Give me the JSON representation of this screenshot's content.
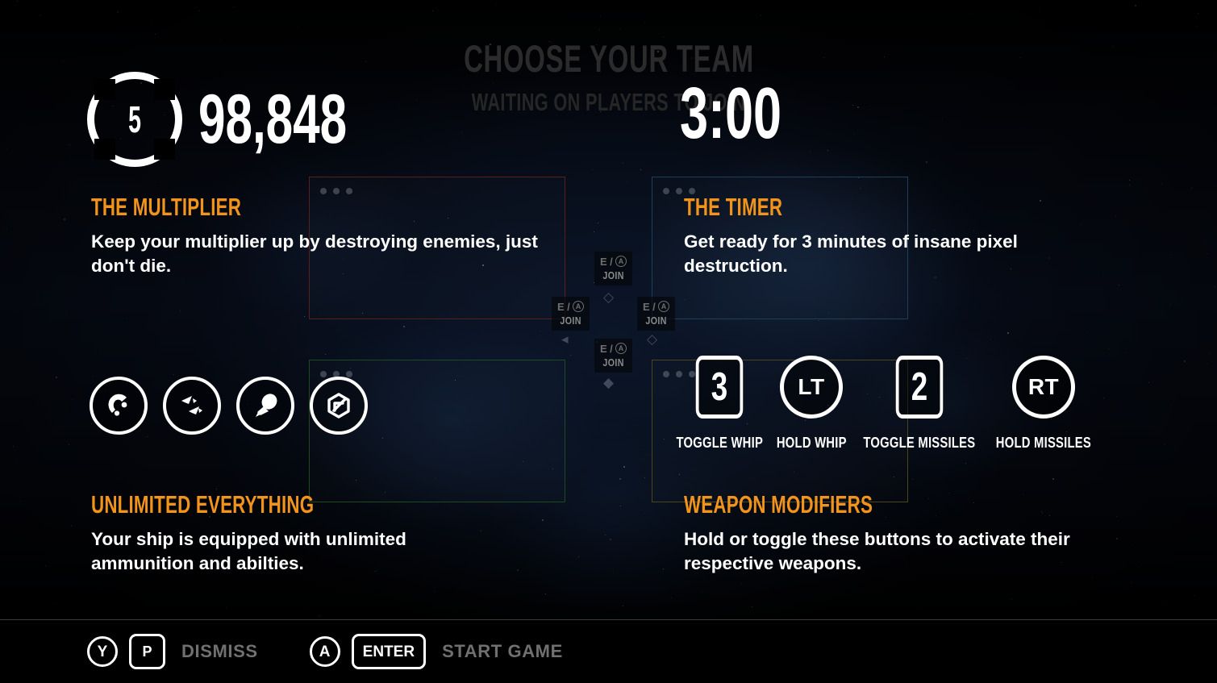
{
  "hud": {
    "multiplier_value": "5",
    "score": "98,848",
    "countdown": "3:00"
  },
  "header": {
    "title": "CHOOSE YOUR TEAM",
    "subtitle": "WAITING ON PLAYERS TO JOIN"
  },
  "join_prompts": [
    {
      "keyboard_key": "E",
      "separator": "/",
      "gamepad_button": "A",
      "label": "JOIN"
    },
    {
      "keyboard_key": "E",
      "separator": "/",
      "gamepad_button": "A",
      "label": "JOIN"
    },
    {
      "keyboard_key": "E",
      "separator": "/",
      "gamepad_button": "A",
      "label": "JOIN"
    },
    {
      "keyboard_key": "E",
      "separator": "/",
      "gamepad_button": "A",
      "label": "JOIN"
    }
  ],
  "tips": {
    "multiplier": {
      "heading": "THE MULTIPLIER",
      "body": "Keep your multiplier up by destroying enemies, just don't die."
    },
    "timer": {
      "heading": "THE TIMER",
      "body": "Get ready for 3 minutes of insane pixel destruction."
    },
    "unlimited": {
      "heading": "UNLIMITED EVERYTHING",
      "body": "Your ship is equipped with unlimited ammunition and abilties."
    },
    "weapons": {
      "heading": "WEAPON MODIFIERS",
      "body": "Hold or toggle these buttons to activate their respective weapons."
    }
  },
  "abilities": [
    {
      "icon": "magnet-icon"
    },
    {
      "icon": "missiles-icon"
    },
    {
      "icon": "bomb-icon"
    },
    {
      "icon": "dash-icon"
    }
  ],
  "weapon_modifiers": [
    {
      "key": "3",
      "shape": "square",
      "label": "TOGGLE WHIP"
    },
    {
      "key": "LT",
      "shape": "circle",
      "label": "HOLD WHIP"
    },
    {
      "key": "2",
      "shape": "square",
      "label": "TOGGLE MISSILES"
    },
    {
      "key": "RT",
      "shape": "circle",
      "label": "HOLD MISSILES"
    }
  ],
  "footer": {
    "bindings": [
      {
        "gamepad": "Y",
        "key": "P",
        "label": "DISMISS"
      },
      {
        "gamepad": "A",
        "key": "ENTER",
        "label": "START GAME"
      }
    ]
  },
  "colors": {
    "accent_orange": "#F2941C",
    "text_white": "#FFFFFF",
    "text_dim": "#707070",
    "slot_border_red": "#5a1e1e",
    "slot_border_blue": "#1e3e5a",
    "slot_border_green": "#1e4a22",
    "slot_border_yellow": "#4a451e"
  }
}
